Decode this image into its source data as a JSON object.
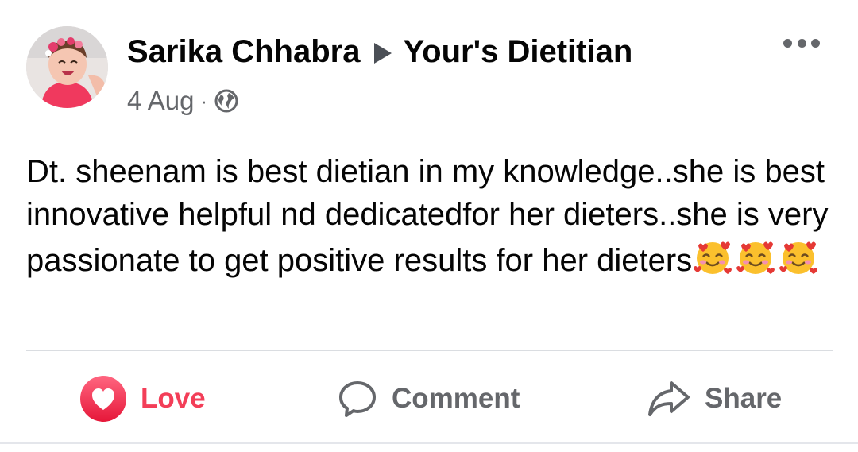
{
  "post": {
    "author": "Sarika Chhabra",
    "target": "Your's Dietitian",
    "date": "4 Aug",
    "separator": "·",
    "privacy_icon": "globe-icon",
    "more_icon": "more-options-icon",
    "text": "Dt. sheenam is best dietian in my knowledge..she is best innovative helpful nd dedicatedfor her dieters..she is very passionate to get positive results for her dieters",
    "emoji": "smiling-face-with-hearts-emoji",
    "emoji_count": 3
  },
  "actions": {
    "love_label": "Love",
    "comment_label": "Comment",
    "share_label": "Share"
  },
  "colors": {
    "love": "#f33e58",
    "secondary_text": "#65676b",
    "primary_text": "#050505",
    "divider": "#dadde1"
  }
}
